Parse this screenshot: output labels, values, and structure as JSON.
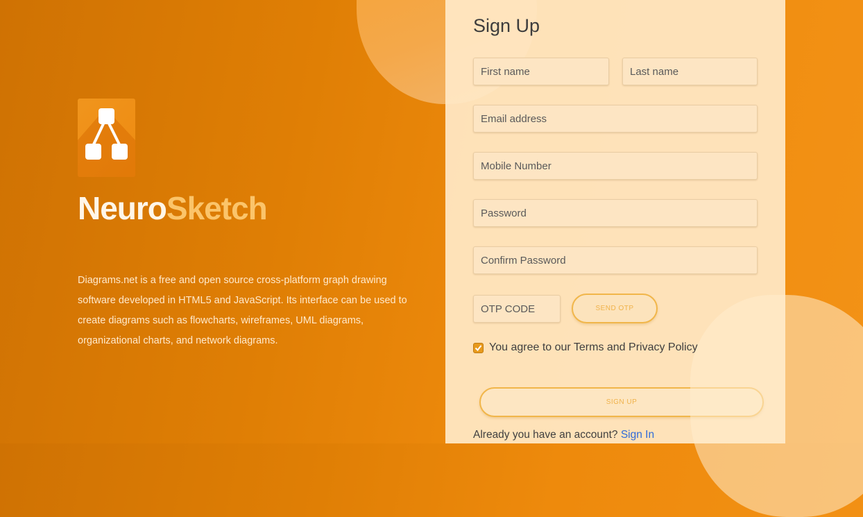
{
  "colors": {
    "accent": "#ee8a10",
    "brand_primary": "#fff6e8",
    "brand_secondary": "#fbc46a",
    "link": "#2f6bd8",
    "button_border": "#f1b64a"
  },
  "brand": {
    "logo_icon": "diagram-flowchart-icon",
    "name_part1": "Neuro",
    "name_part2": "Sketch",
    "description": "Diagrams.net is a free and open source cross-platform graph drawing software developed in HTML5 and JavaScript. Its interface can be used to create diagrams such as flowcharts, wireframes, UML diagrams, organizational charts, and network diagrams."
  },
  "form": {
    "title": "Sign Up",
    "first_name": {
      "placeholder": "First name",
      "value": ""
    },
    "last_name": {
      "placeholder": "Last name",
      "value": ""
    },
    "email": {
      "placeholder": "Email address",
      "value": ""
    },
    "mobile": {
      "placeholder": "Mobile Number",
      "value": ""
    },
    "password": {
      "placeholder": "Password",
      "value": ""
    },
    "confirm_password": {
      "placeholder": "Confirm Password",
      "value": ""
    },
    "otp": {
      "placeholder": "OTP CODE",
      "value": ""
    },
    "send_otp_label": "SEND OTP",
    "agree_checked": true,
    "agree_text": "You agree to our Terms and Privacy Policy",
    "signup_label": "SIGN UP",
    "already_text": "Already you have an account?",
    "signin_label": "Sign In"
  }
}
